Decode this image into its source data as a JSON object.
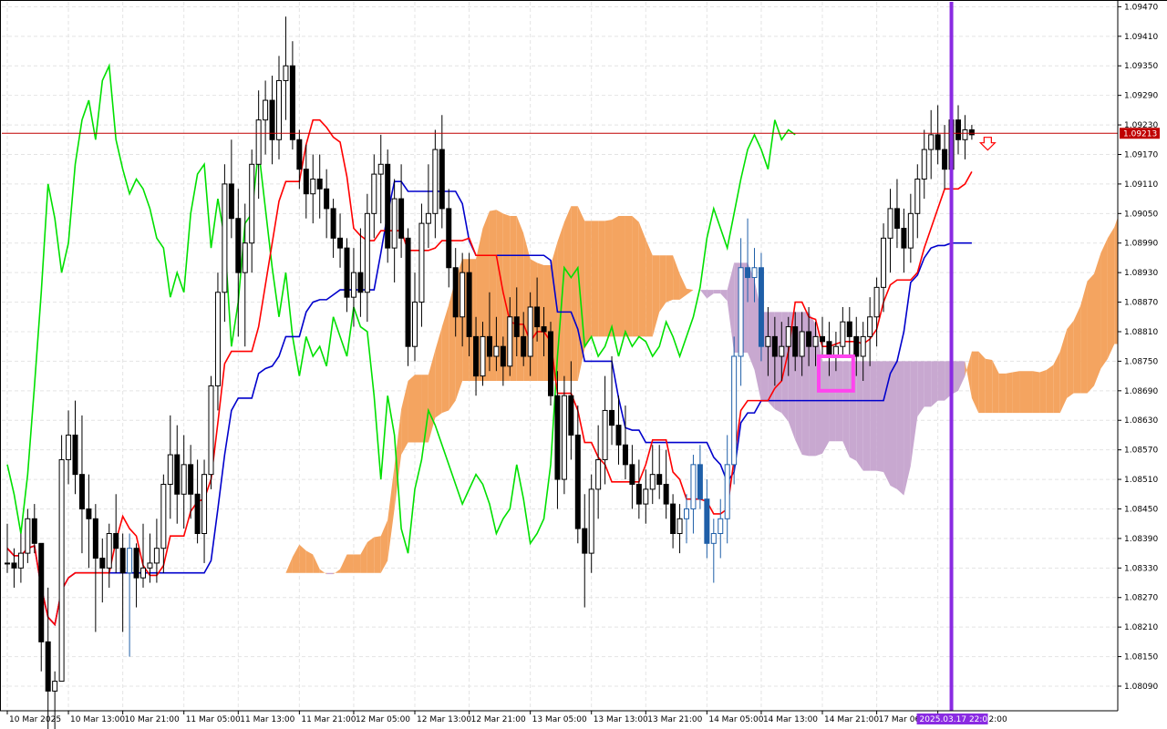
{
  "chart_data": {
    "type": "candlestick",
    "instrument_timeframe": "",
    "y_axis": {
      "ylim": [
        1.0804,
        1.0948
      ],
      "ticks": [
        "1.09470",
        "1.09410",
        "1.09350",
        "1.09290",
        "1.09230",
        "1.09170",
        "1.09110",
        "1.09050",
        "1.08990",
        "1.08930",
        "1.08870",
        "1.08810",
        "1.08750",
        "1.08690",
        "1.08630",
        "1.08570",
        "1.08510",
        "1.08450",
        "1.08390",
        "1.08330",
        "1.08270",
        "1.08210",
        "1.08150",
        "1.08090"
      ],
      "tick_values": [
        1.0947,
        1.0941,
        1.0935,
        1.0929,
        1.0923,
        1.0917,
        1.0911,
        1.0905,
        1.0899,
        1.0893,
        1.0887,
        1.0881,
        1.0875,
        1.0869,
        1.0863,
        1.0857,
        1.0851,
        1.0845,
        1.0839,
        1.0833,
        1.0827,
        1.0821,
        1.0815,
        1.0809
      ]
    },
    "x_axis": {
      "ticks": [
        "10 Mar 2025",
        "10 Mar 13:00",
        "10 Mar 21:00",
        "11 Mar 05:00",
        "11 Mar 13:00",
        "11 Mar 21:00",
        "12 Mar 05:00",
        "12 Mar 13:00",
        "12 Mar 21:00",
        "13 Mar 05:00",
        "13 Mar 13:00",
        "13 Mar 21:00",
        "14 Mar 05:00",
        "14 Mar 13:00",
        "14 Mar 21:00",
        "17 Mar 06:00",
        "17 Ma"
      ],
      "trailing_fragment": "2:00"
    },
    "current_price": {
      "label": "1.09213",
      "value": 1.09213
    },
    "cursor_time_label": "2025.03.17 22:00",
    "grid": true,
    "colors": {
      "bull": "#000000",
      "bear": "#000000",
      "highlight_candles": "#1f5fa8",
      "tenkan": "#ff0000",
      "kijun": "#0000cc",
      "chikou": "#00e000",
      "cloud_bull": "#f4a460",
      "cloud_bear": "#c8a8d0",
      "price_line": "#c00000",
      "cursor_line": "#8a2be2",
      "marker_box": "#ff44ee",
      "signal_arrow": "#ff0000",
      "senkou_chikou_overlap": "#e060b0"
    },
    "candles": [
      [
        1.0834,
        1.0842,
        1.0832,
        1.0834
      ],
      [
        1.0834,
        1.0837,
        1.0829,
        1.0833
      ],
      [
        1.0833,
        1.084,
        1.083,
        1.0836
      ],
      [
        1.0836,
        1.0845,
        1.0834,
        1.0843
      ],
      [
        1.0843,
        1.0846,
        1.0836,
        1.0838
      ],
      [
        1.0838,
        1.0838,
        1.0812,
        1.0818
      ],
      [
        1.0818,
        1.0829,
        1.08,
        1.0808
      ],
      [
        1.0808,
        1.0812,
        1.0797,
        1.081
      ],
      [
        1.081,
        1.086,
        1.081,
        1.0855
      ],
      [
        1.0855,
        1.0865,
        1.085,
        1.086
      ],
      [
        1.086,
        1.0867,
        1.0848,
        1.0852
      ],
      [
        1.0852,
        1.0864,
        1.0836,
        1.0845
      ],
      [
        1.0845,
        1.0852,
        1.0833,
        1.0843
      ],
      [
        1.0843,
        1.0846,
        1.082,
        1.0835
      ],
      [
        1.0835,
        1.0839,
        1.0826,
        1.0833
      ],
      [
        1.0833,
        1.0842,
        1.0829,
        1.084
      ],
      [
        1.084,
        1.0848,
        1.0832,
        1.0837
      ],
      [
        1.0837,
        1.084,
        1.082,
        1.0832
      ],
      [
        1.0832,
        1.084,
        1.0815,
        1.0837
      ],
      [
        1.0837,
        1.0838,
        1.0825,
        1.0831
      ],
      [
        1.0831,
        1.0842,
        1.0829,
        1.0833
      ],
      [
        1.0833,
        1.084,
        1.083,
        1.0834
      ],
      [
        1.0834,
        1.0843,
        1.083,
        1.0837
      ],
      [
        1.0837,
        1.0852,
        1.0832,
        1.085
      ],
      [
        1.085,
        1.0864,
        1.0843,
        1.0856
      ],
      [
        1.0856,
        1.0862,
        1.0842,
        1.0848
      ],
      [
        1.0848,
        1.086,
        1.0841,
        1.0854
      ],
      [
        1.0854,
        1.0858,
        1.0843,
        1.0848
      ],
      [
        1.0848,
        1.0855,
        1.0838,
        1.084
      ],
      [
        1.084,
        1.0855,
        1.0834,
        1.0852
      ],
      [
        1.0852,
        1.0872,
        1.0849,
        1.087
      ],
      [
        1.087,
        1.0893,
        1.0865,
        1.0889
      ],
      [
        1.0889,
        1.0915,
        1.0883,
        1.0911
      ],
      [
        1.0911,
        1.092,
        1.09,
        1.0904
      ],
      [
        1.0904,
        1.091,
        1.088,
        1.0893
      ],
      [
        1.0893,
        1.0907,
        1.0878,
        1.0899
      ],
      [
        1.0899,
        1.0918,
        1.0893,
        1.0915
      ],
      [
        1.0915,
        1.093,
        1.0908,
        1.0924
      ],
      [
        1.0924,
        1.0932,
        1.0917,
        1.0928
      ],
      [
        1.0928,
        1.0933,
        1.0915,
        1.092
      ],
      [
        1.092,
        1.0937,
        1.0916,
        1.0932
      ],
      [
        1.0932,
        1.0945,
        1.0924,
        1.0935
      ],
      [
        1.0935,
        1.094,
        1.0918,
        1.092
      ],
      [
        1.092,
        1.0922,
        1.091,
        1.0914
      ],
      [
        1.0914,
        1.0919,
        1.0904,
        1.0909
      ],
      [
        1.0909,
        1.0917,
        1.0903,
        1.0912
      ],
      [
        1.0912,
        1.0917,
        1.0904,
        1.091
      ],
      [
        1.091,
        1.0914,
        1.09,
        1.0906
      ],
      [
        1.0906,
        1.0908,
        1.0896,
        1.09
      ],
      [
        1.09,
        1.0905,
        1.0894,
        1.0898
      ],
      [
        1.0898,
        1.09,
        1.0885,
        1.0888
      ],
      [
        1.0888,
        1.0898,
        1.0882,
        1.0893
      ],
      [
        1.0893,
        1.0902,
        1.0884,
        1.0889
      ],
      [
        1.0889,
        1.0909,
        1.0883,
        1.0905
      ],
      [
        1.0905,
        1.0917,
        1.09,
        1.0913
      ],
      [
        1.0913,
        1.0921,
        1.0903,
        1.0915
      ],
      [
        1.0915,
        1.0918,
        1.0895,
        1.0898
      ],
      [
        1.0898,
        1.0912,
        1.0891,
        1.0908
      ],
      [
        1.0908,
        1.0915,
        1.0896,
        1.09
      ],
      [
        1.09,
        1.0902,
        1.0874,
        1.0878
      ],
      [
        1.0878,
        1.0893,
        1.0875,
        1.0887
      ],
      [
        1.0887,
        1.0907,
        1.0882,
        1.0903
      ],
      [
        1.0903,
        1.0915,
        1.0898,
        1.0905
      ],
      [
        1.0905,
        1.0922,
        1.09,
        1.0918
      ],
      [
        1.0918,
        1.0925,
        1.0902,
        1.0906
      ],
      [
        1.0906,
        1.091,
        1.089,
        1.0894
      ],
      [
        1.0894,
        1.0898,
        1.088,
        1.0884
      ],
      [
        1.0884,
        1.0897,
        1.0878,
        1.0893
      ],
      [
        1.0893,
        1.0897,
        1.0876,
        1.088
      ],
      [
        1.088,
        1.0884,
        1.0868,
        1.0872
      ],
      [
        1.0872,
        1.0883,
        1.087,
        1.088
      ],
      [
        1.088,
        1.0889,
        1.0873,
        1.0876
      ],
      [
        1.0876,
        1.0884,
        1.0873,
        1.0878
      ],
      [
        1.0878,
        1.088,
        1.087,
        1.0874
      ],
      [
        1.0874,
        1.0888,
        1.0872,
        1.0884
      ],
      [
        1.0884,
        1.089,
        1.0876,
        1.088
      ],
      [
        1.088,
        1.0885,
        1.0874,
        1.0876
      ],
      [
        1.0876,
        1.0889,
        1.0872,
        1.0886
      ],
      [
        1.0886,
        1.0892,
        1.0879,
        1.0882
      ],
      [
        1.0882,
        1.0886,
        1.0876,
        1.0881
      ],
      [
        1.0881,
        1.0883,
        1.0866,
        1.0868
      ],
      [
        1.0868,
        1.0873,
        1.0845,
        1.0851
      ],
      [
        1.0851,
        1.0872,
        1.0848,
        1.0868
      ],
      [
        1.0868,
        1.0875,
        1.0855,
        1.086
      ],
      [
        1.086,
        1.0866,
        1.0838,
        1.0841
      ],
      [
        1.0841,
        1.0848,
        1.0825,
        1.0836
      ],
      [
        1.0836,
        1.0852,
        1.0832,
        1.0849
      ],
      [
        1.0849,
        1.0862,
        1.0843,
        1.0855
      ],
      [
        1.0855,
        1.0872,
        1.085,
        1.0865
      ],
      [
        1.0865,
        1.0876,
        1.0858,
        1.0862
      ],
      [
        1.0862,
        1.0868,
        1.0854,
        1.0858
      ],
      [
        1.0858,
        1.0866,
        1.0851,
        1.0854
      ],
      [
        1.0854,
        1.0858,
        1.0845,
        1.085
      ],
      [
        1.085,
        1.0855,
        1.0843,
        1.0846
      ],
      [
        1.0846,
        1.0853,
        1.0842,
        1.0849
      ],
      [
        1.0849,
        1.0858,
        1.0846,
        1.0852
      ],
      [
        1.0852,
        1.0858,
        1.0847,
        1.085
      ],
      [
        1.085,
        1.0857,
        1.0843,
        1.0846
      ],
      [
        1.0846,
        1.0848,
        1.0837,
        1.084
      ],
      [
        1.084,
        1.0846,
        1.0836,
        1.0843
      ],
      [
        1.0843,
        1.0848,
        1.0838,
        1.0845
      ],
      [
        1.0845,
        1.0856,
        1.084,
        1.0854
      ],
      [
        1.0854,
        1.0858,
        1.0845,
        1.0847
      ],
      [
        1.0847,
        1.0851,
        1.0835,
        1.0838
      ],
      [
        1.0838,
        1.0843,
        1.083,
        1.084
      ],
      [
        1.084,
        1.0847,
        1.0835,
        1.0843
      ],
      [
        1.0843,
        1.086,
        1.0838,
        1.0854
      ],
      [
        1.0854,
        1.088,
        1.085,
        1.0876
      ],
      [
        1.0876,
        1.09,
        1.087,
        1.0894
      ],
      [
        1.0894,
        1.0904,
        1.0887,
        1.0892
      ],
      [
        1.0892,
        1.0898,
        1.0887,
        1.0894
      ],
      [
        1.0894,
        1.0897,
        1.0875,
        1.0878
      ],
      [
        1.0878,
        1.0886,
        1.0872,
        1.088
      ],
      [
        1.088,
        1.0884,
        1.087,
        1.0876
      ],
      [
        1.0876,
        1.0883,
        1.0871,
        1.0878
      ],
      [
        1.0878,
        1.0884,
        1.0872,
        1.0882
      ],
      [
        1.0882,
        1.0885,
        1.0873,
        1.0876
      ],
      [
        1.0876,
        1.0885,
        1.0872,
        1.0881
      ],
      [
        1.0881,
        1.0886,
        1.0874,
        1.0878
      ],
      [
        1.0878,
        1.0883,
        1.0874,
        1.088
      ],
      [
        1.088,
        1.0884,
        1.0876,
        1.0879
      ],
      [
        1.0879,
        1.0883,
        1.0872,
        1.0876
      ],
      [
        1.0876,
        1.0881,
        1.0873,
        1.0878
      ],
      [
        1.0878,
        1.0886,
        1.0876,
        1.0883
      ],
      [
        1.0883,
        1.0886,
        1.0876,
        1.088
      ],
      [
        1.088,
        1.0884,
        1.0872,
        1.0876
      ],
      [
        1.0876,
        1.0883,
        1.0871,
        1.088
      ],
      [
        1.088,
        1.0888,
        1.0874,
        1.0884
      ],
      [
        1.0884,
        1.0892,
        1.0878,
        1.089
      ],
      [
        1.089,
        1.0903,
        1.0885,
        1.09
      ],
      [
        1.09,
        1.091,
        1.0893,
        1.0906
      ],
      [
        1.0906,
        1.0912,
        1.0898,
        1.0902
      ],
      [
        1.0902,
        1.0906,
        1.0893,
        1.0898
      ],
      [
        1.0898,
        1.0909,
        1.0895,
        1.0905
      ],
      [
        1.0905,
        1.0915,
        1.09,
        1.0912
      ],
      [
        1.0912,
        1.0922,
        1.0908,
        1.0918
      ],
      [
        1.0918,
        1.0926,
        1.0912,
        1.0921
      ],
      [
        1.0921,
        1.0927,
        1.0915,
        1.0918
      ],
      [
        1.0918,
        1.0923,
        1.091,
        1.0914
      ],
      [
        1.0914,
        1.0926,
        1.0912,
        1.0924
      ],
      [
        1.0924,
        1.0927,
        1.0917,
        1.092
      ],
      [
        1.092,
        1.0925,
        1.0916,
        1.0922
      ],
      [
        1.0922,
        1.0923,
        1.092,
        1.0921
      ]
    ],
    "highlight_candle_indices": [
      18,
      100,
      101,
      102,
      103,
      104,
      105,
      106,
      107,
      108,
      109,
      110,
      111
    ],
    "marker_box_candle_range": [
      120,
      124
    ],
    "marker_box_price_range": [
      1.0869,
      1.0876
    ],
    "signal_arrow_price": 1.0919
  }
}
